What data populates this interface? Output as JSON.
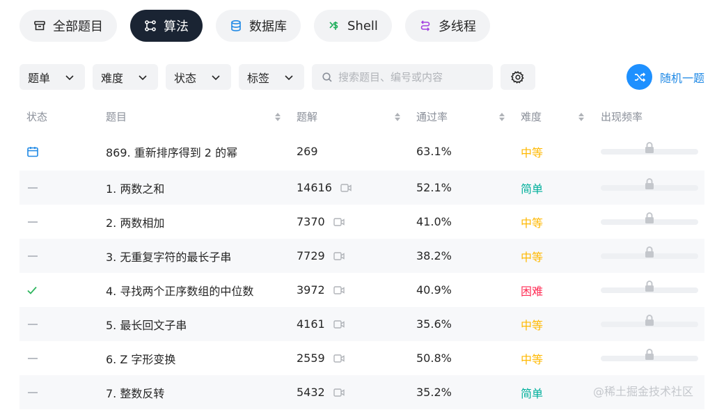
{
  "tabs": [
    {
      "label": "全部题目",
      "icon": "archive-icon",
      "active": false
    },
    {
      "label": "算法",
      "icon": "algorithm-icon",
      "active": true
    },
    {
      "label": "数据库",
      "icon": "database-icon",
      "active": false
    },
    {
      "label": "Shell",
      "icon": "shell-icon",
      "active": false
    },
    {
      "label": "多线程",
      "icon": "thread-icon",
      "active": false
    }
  ],
  "filters": {
    "list": "题单",
    "difficulty": "难度",
    "status": "状态",
    "tags": "标签",
    "search_placeholder": "搜索题目、编号或内容",
    "random_label": "随机一题"
  },
  "table": {
    "headers": {
      "status": "状态",
      "title": "题目",
      "solutions": "题解",
      "pass_rate": "通过率",
      "difficulty": "难度",
      "frequency": "出现频率"
    },
    "rows": [
      {
        "status": "daily",
        "title": "869. 重新排序得到 2 的幂",
        "solutions": "269",
        "video": false,
        "pass_rate": "63.1%",
        "difficulty": "中等",
        "level": "medium"
      },
      {
        "status": "none",
        "title": "1. 两数之和",
        "solutions": "14616",
        "video": true,
        "pass_rate": "52.1%",
        "difficulty": "简单",
        "level": "easy"
      },
      {
        "status": "none",
        "title": "2. 两数相加",
        "solutions": "7370",
        "video": true,
        "pass_rate": "41.0%",
        "difficulty": "中等",
        "level": "medium"
      },
      {
        "status": "none",
        "title": "3. 无重复字符的最长子串",
        "solutions": "7729",
        "video": true,
        "pass_rate": "38.2%",
        "difficulty": "中等",
        "level": "medium"
      },
      {
        "status": "solved",
        "title": "4. 寻找两个正序数组的中位数",
        "solutions": "3972",
        "video": true,
        "pass_rate": "40.9%",
        "difficulty": "困难",
        "level": "hard"
      },
      {
        "status": "none",
        "title": "5. 最长回文子串",
        "solutions": "4161",
        "video": true,
        "pass_rate": "35.6%",
        "difficulty": "中等",
        "level": "medium"
      },
      {
        "status": "none",
        "title": "6. Z 字形变换",
        "solutions": "2559",
        "video": true,
        "pass_rate": "50.8%",
        "difficulty": "中等",
        "level": "medium"
      },
      {
        "status": "none",
        "title": "7. 整数反转",
        "solutions": "5432",
        "video": true,
        "pass_rate": "35.2%",
        "difficulty": "简单",
        "level": "easy"
      }
    ]
  },
  "colors": {
    "easy": "#00af9b",
    "medium": "#ffb800",
    "hard": "#ff2d55",
    "accent": "#1e90ff",
    "active_tab": "#1a2433"
  },
  "watermark": "@稀土掘金技术社区"
}
